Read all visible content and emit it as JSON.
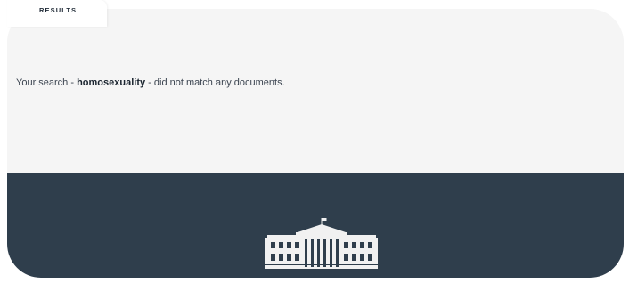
{
  "tab": {
    "label": "RESULTS"
  },
  "search": {
    "prefix": "Your search - ",
    "term": "homosexuality",
    "suffix": " - did not match any documents."
  },
  "footer": {
    "logo_icon": "white-house-icon",
    "background_color": "#2f3e4c"
  }
}
